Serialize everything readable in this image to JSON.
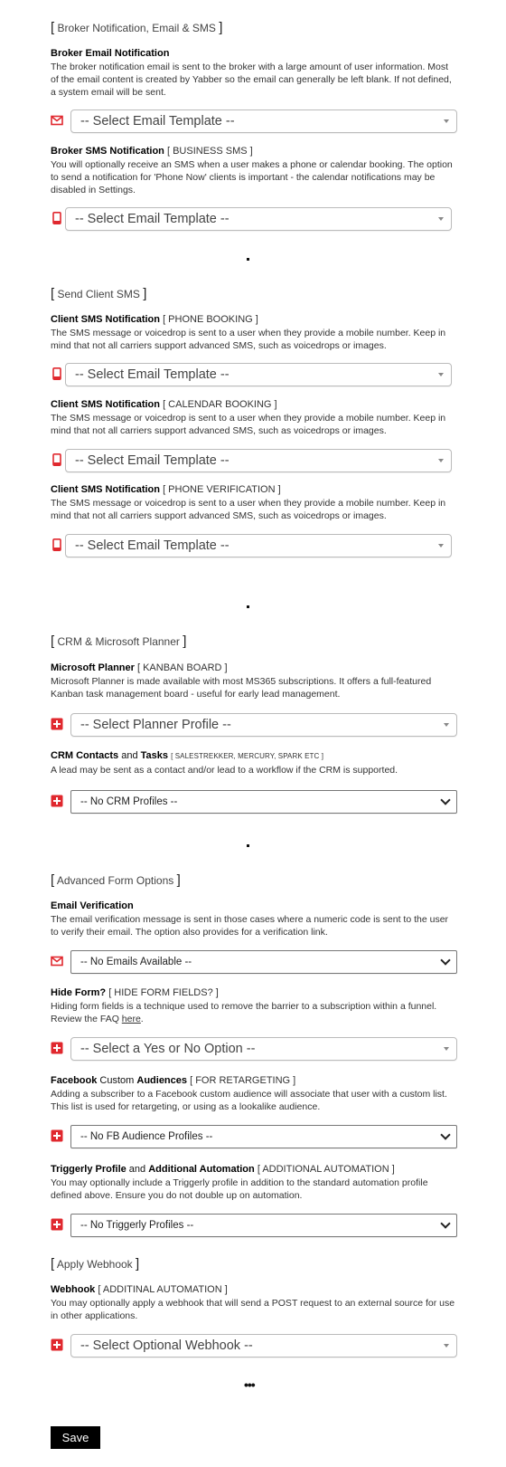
{
  "colors": {
    "icon_red": "#e0282e",
    "save_bg": "#000000",
    "save_text": "#ffffff"
  },
  "sections": {
    "broker": {
      "title": "Broker Notification, Email & SMS"
    },
    "client_sms": {
      "title": "Send Client SMS"
    },
    "crm": {
      "title": "CRM & Microsoft Planner"
    },
    "advanced": {
      "title": "Advanced Form Options"
    },
    "webhook_section": {
      "title": "Apply Webhook"
    }
  },
  "fields": {
    "broker_email": {
      "title": "Broker Email Notification",
      "desc": "The broker notification email is sent to the broker with a large amount of user information. Most of the email content is created by Yabber so the email can generally be left blank. If not defined, a system email will be sent.",
      "icon": "envelope-icon",
      "value": "-- Select Email Template --"
    },
    "broker_sms": {
      "title": "Broker SMS Notification",
      "tag": "[ BUSINESS SMS ]",
      "desc": "You will optionally receive an SMS when a user makes a phone or calendar booking. The option to send a notification for 'Phone Now' clients is important - the calendar notifications may be disabled in Settings.",
      "icon": "mobile-phone-icon",
      "value": "-- Select Email Template --"
    },
    "client_phone": {
      "title": "Client SMS Notification",
      "tag": "[ PHONE BOOKING ]",
      "desc": "The SMS message or voicedrop is sent to a user when they provide a mobile number. Keep in mind that not all carriers support advanced SMS, such as voicedrops or images.",
      "icon": "mobile-phone-icon",
      "value": "-- Select Email Template --"
    },
    "client_calendar": {
      "title": "Client SMS Notification",
      "tag": "[ CALENDAR BOOKING ]",
      "desc": "The SMS message or voicedrop is sent to a user when they provide a mobile number. Keep in mind that not all carriers support advanced SMS, such as voicedrops or images.",
      "icon": "mobile-phone-icon",
      "value": "-- Select Email Template --"
    },
    "client_verify": {
      "title": "Client SMS Notification",
      "tag": "[ PHONE VERIFICATION ]",
      "desc": "The SMS message or voicedrop is sent to a user when they provide a mobile number. Keep in mind that not all carriers support advanced SMS, such as voicedrops or images.",
      "icon": "mobile-phone-icon",
      "value": "-- Select Email Template --"
    },
    "planner": {
      "title": "Microsoft Planner",
      "tag": "[ KANBAN BOARD ]",
      "desc": "Microsoft Planner is made available with most MS365 subscriptions. It offers a full-featured Kanban task management board - useful for early lead management.",
      "icon": "plus-square-icon",
      "value": "-- Select Planner Profile --"
    },
    "crm": {
      "title_a": "CRM Contacts",
      "title_mid": " and ",
      "title_b": "Tasks",
      "tag": "[ SALESTREKKER, MERCURY, SPARK ETC ]",
      "desc": "A lead may be sent as a contact and/or lead to a workflow if the CRM is supported.",
      "icon": "plus-square-icon",
      "value": "-- No CRM Profiles --"
    },
    "email_verify": {
      "title": "Email Verification",
      "desc": "The email verification message is sent in those cases where a numeric code is sent to the user to verify their email. The option also provides for a verification link.",
      "icon": "envelope-icon",
      "value": "-- No Emails Available --"
    },
    "hide_form": {
      "title": "Hide Form?",
      "tag": "[ HIDE FORM FIELDS? ]",
      "desc": "Hiding form fields is a technique used to remove the barrier to a subscription within a funnel. Review the FAQ ",
      "link": "here",
      "desc_end": ".",
      "icon": "plus-square-icon",
      "value": "-- Select a Yes or No Option --"
    },
    "facebook": {
      "title_a": "Facebook",
      "title_mid": " Custom ",
      "title_b": "Audiences",
      "tag": "[ FOR RETARGETING ]",
      "desc": "Adding a subscriber to a Facebook custom audience will associate that user with a custom list. This list is used for retargeting, or using as a lookalike audience.",
      "icon": "plus-square-icon",
      "value": "-- No FB Audience Profiles --"
    },
    "triggerly": {
      "title_a": "Triggerly Profile",
      "title_mid": " and ",
      "title_b": "Additional Automation",
      "tag": "[ ADDITIONAL AUTOMATION ]",
      "desc": "You may optionally include a Triggerly profile in addition to the standard automation profile defined above. Ensure you do not double up on automation.",
      "icon": "plus-square-icon",
      "value": "-- No Triggerly Profiles --"
    },
    "webhook": {
      "title": "Webhook",
      "tag": "[ ADDITINAL AUTOMATION ]",
      "desc": "You may optionally apply a webhook that will send a POST request to an external source for use in other applications.",
      "icon": "plus-square-icon",
      "value": "-- Select Optional Webhook --"
    }
  },
  "bracket_open": "[",
  "bracket_close": "]",
  "ellipsis": "•••",
  "save_label": "Save"
}
